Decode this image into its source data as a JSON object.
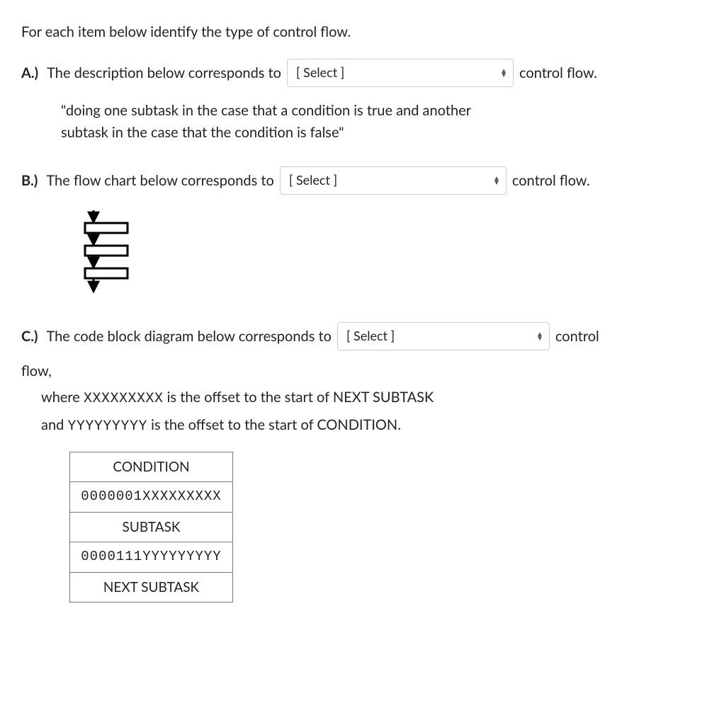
{
  "intro": "For each item below identify the type of control flow.",
  "items": {
    "a": {
      "marker": "A.)",
      "prompt_before": "The description below corresponds to",
      "select_placeholder": "[ Select ]",
      "prompt_after": "control flow.",
      "quote": "\"doing one subtask in the case that a condition is true and another subtask in the case that the condition is false\""
    },
    "b": {
      "marker": "B.)",
      "prompt_before": "The flow chart below corresponds to",
      "select_placeholder": "[ Select ]",
      "prompt_after": "control flow."
    },
    "c": {
      "marker": "C.)",
      "prompt_before": "The code block diagram below corresponds to",
      "select_placeholder": "[ Select ]",
      "prompt_after": "control",
      "flow_line": "flow,",
      "explain1_pre": "where ",
      "explain1_x": "XXXXXXXXX",
      "explain1_post": " is the offset to the start of NEXT SUBTASK",
      "explain2_pre": "and ",
      "explain2_y": "YYYYYYYYY",
      "explain2_post": " is the offset to the start of CONDITION.",
      "table": {
        "r1": "CONDITION",
        "r2": "0000001XXXXXXXXX",
        "r3": "SUBTASK",
        "r4": "0000111YYYYYYYYY",
        "r5": "NEXT SUBTASK"
      }
    }
  }
}
